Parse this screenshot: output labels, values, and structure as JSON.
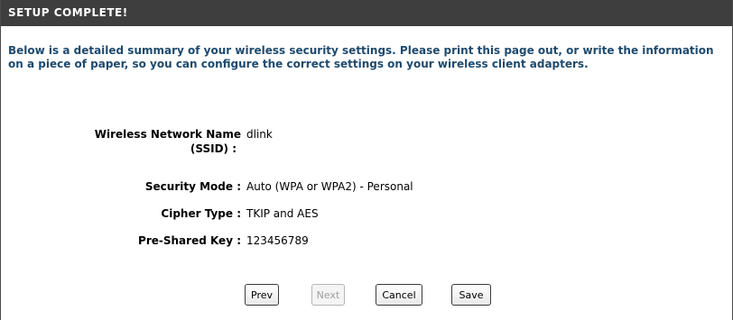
{
  "header": {
    "title": "SETUP COMPLETE!"
  },
  "description": "Below is a detailed summary of your wireless security settings. Please print this page out, or write the information on a piece of paper, so you can configure the correct settings on your wireless client adapters.",
  "fields": {
    "ssid": {
      "label_line1": "Wireless Network Name",
      "label_line2": "(SSID)  :",
      "value": "dlink"
    },
    "security_mode": {
      "label": "Security Mode :",
      "value": "Auto (WPA or WPA2) - Personal"
    },
    "cipher_type": {
      "label": "Cipher Type :",
      "value": "TKIP and AES"
    },
    "pre_shared_key": {
      "label": "Pre-Shared Key :",
      "value": "123456789"
    }
  },
  "buttons": {
    "prev": "Prev",
    "next": "Next",
    "cancel": "Cancel",
    "save": "Save"
  },
  "colors": {
    "header_bg": "#3e3e3e",
    "description_text": "#1e4a6e"
  }
}
